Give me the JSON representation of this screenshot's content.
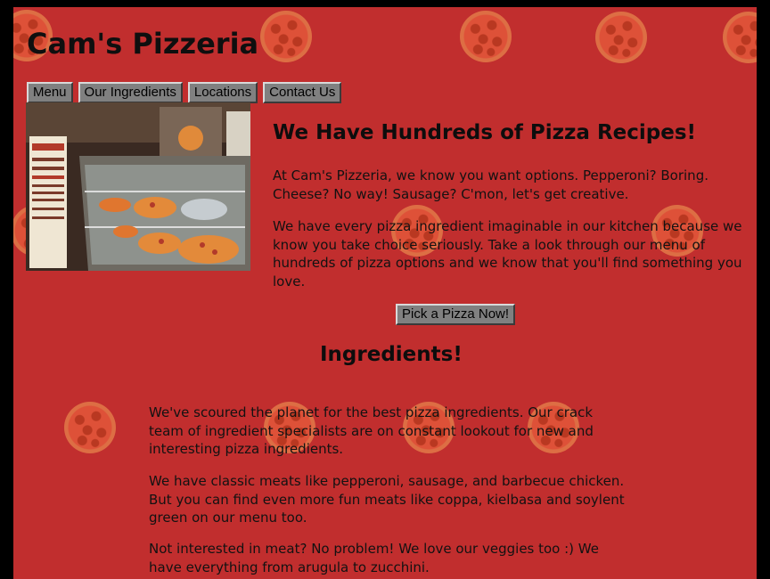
{
  "site": {
    "title": "Cam's Pizzeria"
  },
  "nav": {
    "items": [
      "Menu",
      "Our Ingredients",
      "Locations",
      "Contact Us"
    ]
  },
  "hero": {
    "heading": "We Have Hundreds of Pizza Recipes!",
    "paragraphs": [
      "At Cam's Pizzeria, we know you want options. Pepperoni? Boring. Cheese? No way! Sausage? C'mon, let's get creative.",
      "We have every pizza ingredient imaginable in our kitchen because we know you take choice seriously. Take a look through our menu of hundreds of pizza options and we know that you'll find something you love."
    ],
    "cta_label": "Pick a Pizza Now!"
  },
  "ingredients": {
    "heading": "Ingredients!",
    "paragraphs": [
      "We've scoured the planet for the best pizza ingredients. Our crack team of ingredient specialists are on constant lookout for new and interesting pizza ingredients.",
      "We have classic meats like pepperoni, sausage, and barbecue chicken. But you can find even more fun meats like coppa, kielbasa and soylent green on our menu too.",
      "Not interested in meat? No problem! We love our veggies too :) We have everything from arugula to zucchini."
    ]
  },
  "colors": {
    "page_background": "#c12e2e",
    "outer_background": "#000000",
    "button_background": "#808080"
  }
}
